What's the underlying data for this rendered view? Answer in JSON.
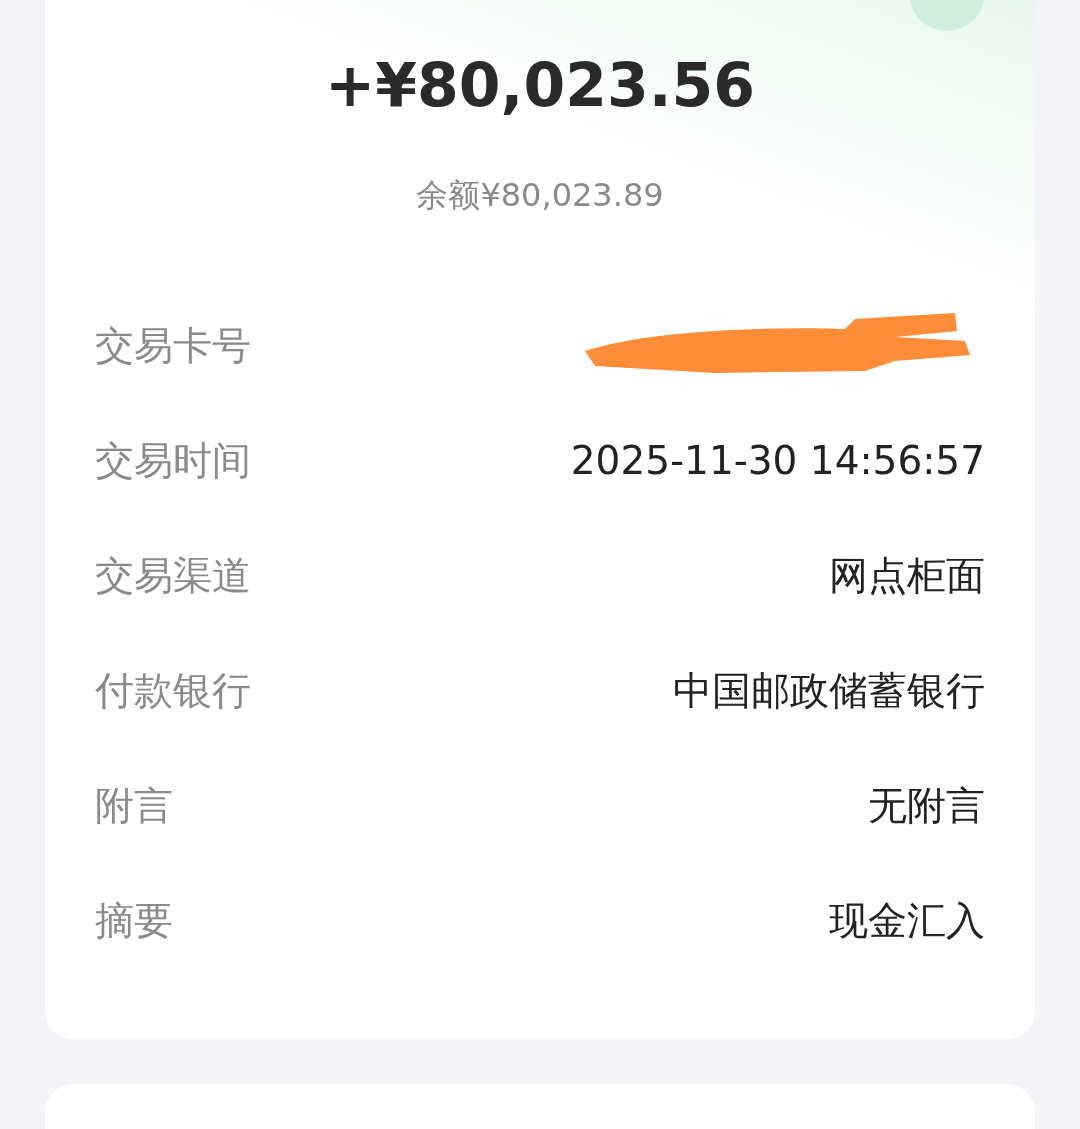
{
  "amount": "+¥80,023.56",
  "balance": "余额¥80,023.89",
  "details": [
    {
      "label": "交易卡号",
      "kind": "redacted"
    },
    {
      "label": "交易时间",
      "kind": "text",
      "value": "2025-11-30 14:56:57"
    },
    {
      "label": "交易渠道",
      "kind": "text",
      "value": "网点柜面"
    },
    {
      "label": "付款银行",
      "kind": "text",
      "value": "中国邮政储蓄银行"
    },
    {
      "label": "附言",
      "kind": "text",
      "value": "无附言"
    },
    {
      "label": "摘要",
      "kind": "text",
      "value": "现金汇入"
    }
  ]
}
